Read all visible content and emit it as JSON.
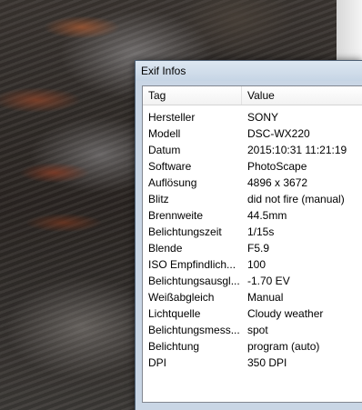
{
  "window": {
    "title": "Exif Infos"
  },
  "table": {
    "columns": {
      "tag": "Tag",
      "value": "Value"
    },
    "rows": [
      {
        "tag": "Hersteller",
        "value": "SONY"
      },
      {
        "tag": "Modell",
        "value": "DSC-WX220"
      },
      {
        "tag": "Datum",
        "value": "2015:10:31 11:21:19"
      },
      {
        "tag": "Software",
        "value": "PhotoScape"
      },
      {
        "tag": "Auflösung",
        "value": "4896 x 3672"
      },
      {
        "tag": "Blitz",
        "value": "did not fire (manual)"
      },
      {
        "tag": "Brennweite",
        "value": "44.5mm"
      },
      {
        "tag": "Belichtungszeit",
        "value": "1/15s"
      },
      {
        "tag": "Blende",
        "value": "F5.9"
      },
      {
        "tag": "ISO Empfindlich...",
        "value": "100"
      },
      {
        "tag": "Belichtungsausgl...",
        "value": "-1.70 EV"
      },
      {
        "tag": "Weißabgleich",
        "value": "Manual"
      },
      {
        "tag": "Lichtquelle",
        "value": "Cloudy weather"
      },
      {
        "tag": "Belichtungsmess...",
        "value": "spot"
      },
      {
        "tag": "Belichtung",
        "value": "program (auto)"
      },
      {
        "tag": "DPI",
        "value": "350 DPI"
      }
    ]
  }
}
